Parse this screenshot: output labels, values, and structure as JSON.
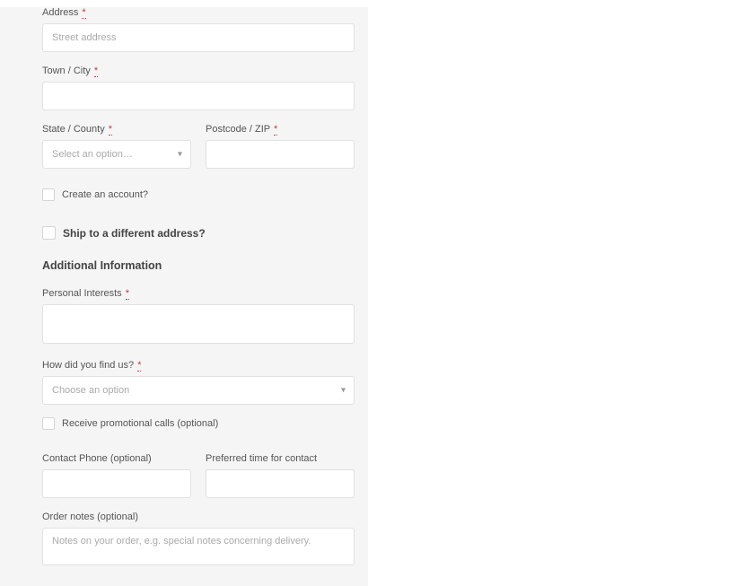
{
  "fields": {
    "address": {
      "label": "Address",
      "required": "*",
      "placeholder": "Street address",
      "value": ""
    },
    "town_city": {
      "label": "Town / City",
      "required": "*",
      "value": ""
    },
    "state_county": {
      "label": "State / County",
      "required": "*",
      "placeholder": "Select an option…"
    },
    "postcode": {
      "label": "Postcode / ZIP",
      "required": "*",
      "value": ""
    },
    "create_account": {
      "label": "Create an account?"
    },
    "ship_different": {
      "label": "Ship to a different address?"
    },
    "additional_header": "Additional Information",
    "personal_interests": {
      "label": "Personal Interests",
      "required": "*",
      "value": ""
    },
    "find_us": {
      "label": "How did you find us?",
      "required": "*",
      "placeholder": "Choose an option"
    },
    "promo_calls": {
      "label": "Receive promotional calls (optional)"
    },
    "contact_phone": {
      "label": "Contact Phone (optional)",
      "value": ""
    },
    "preferred_time": {
      "label": "Preferred time for contact",
      "value": ""
    },
    "order_notes": {
      "label": "Order notes (optional)",
      "placeholder": "Notes on your order, e.g. special notes concerning delivery.",
      "value": ""
    }
  }
}
